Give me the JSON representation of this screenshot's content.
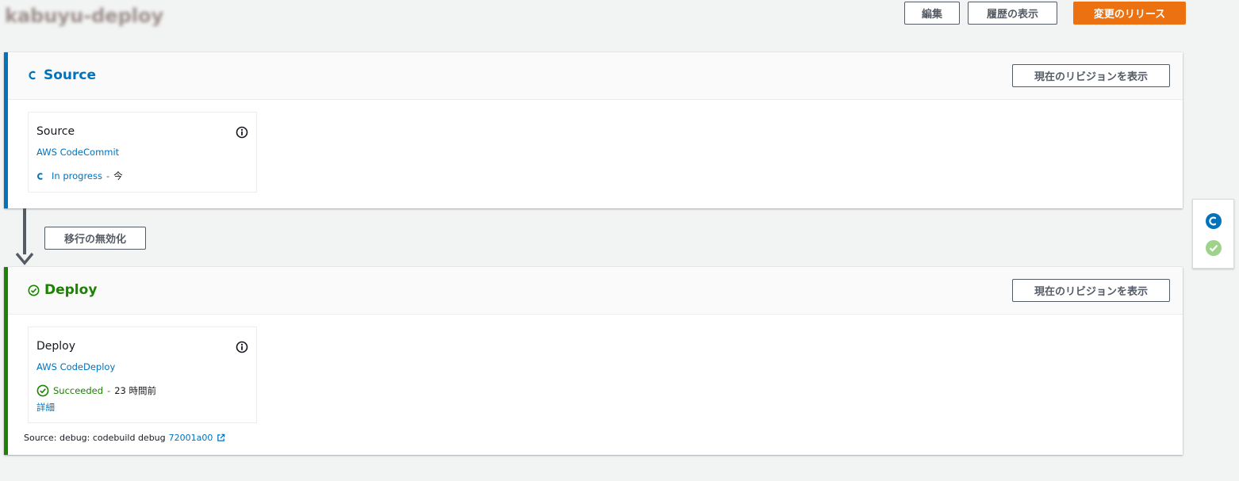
{
  "page": {
    "title": "kabuyu-deploy"
  },
  "header_buttons": {
    "edit": "編集",
    "history": "履歴の表示",
    "release": "変更のリリース"
  },
  "stages": [
    {
      "name": "Source",
      "status_color": "#0073bb",
      "view_revision_label": "現在のリビジョンを表示",
      "action": {
        "name": "Source",
        "provider": "AWS CodeCommit",
        "status": "In progress",
        "separator": "-",
        "time": "今"
      }
    },
    {
      "name": "Deploy",
      "status_color": "#1d8102",
      "view_revision_label": "現在のリビジョンを表示",
      "action": {
        "name": "Deploy",
        "provider": "AWS CodeDeploy",
        "status": "Succeeded",
        "separator": "-",
        "time": "23 時間前",
        "details_label": "詳細"
      },
      "source_info": {
        "prefix": "Source: debug: codebuild debug",
        "commit": "72001a00"
      }
    }
  ],
  "transition": {
    "disable_label": "移行の無効化"
  },
  "side_panel": {
    "icons": [
      "in-progress-icon",
      "succeeded-icon"
    ]
  },
  "colors": {
    "accent_primary": "#ec7211",
    "link": "#0073bb",
    "success": "#1d8102",
    "in_progress": "#0073bb"
  }
}
